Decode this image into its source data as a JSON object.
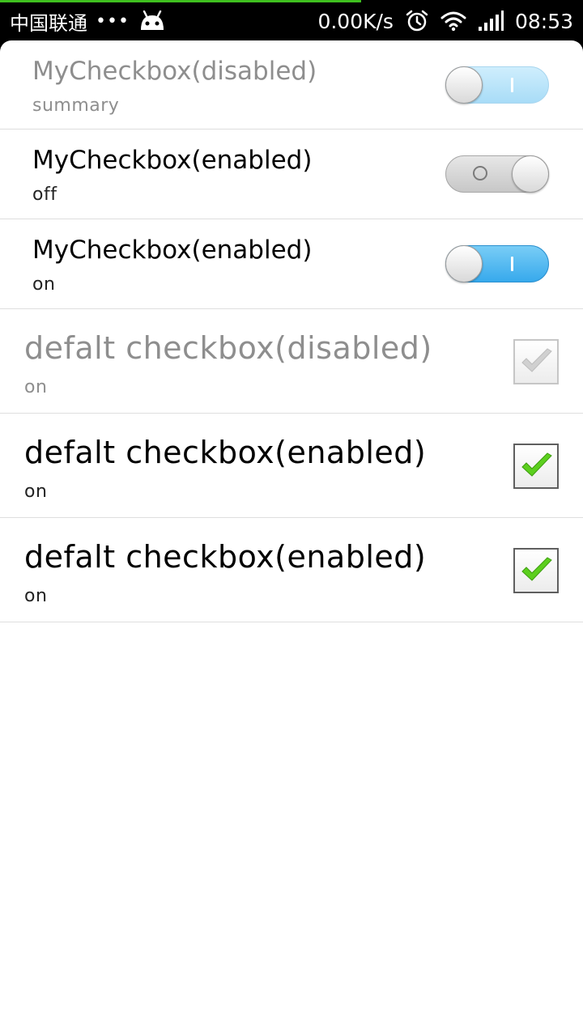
{
  "status_bar": {
    "carrier": "中国联通",
    "dots": "•••",
    "speed": "0.00K/s",
    "time": "08:53",
    "icons": [
      "android-icon",
      "alarm-icon",
      "wifi-icon",
      "signal-icon"
    ],
    "download_progress": 0.62
  },
  "switch_preferences": [
    {
      "title": "MyCheckbox(disabled)",
      "summary": "summary",
      "checked": true,
      "enabled": false
    },
    {
      "title": "MyCheckbox(enabled)",
      "summary": "off",
      "checked": false,
      "enabled": true
    },
    {
      "title": "MyCheckbox(enabled)",
      "summary": "on",
      "checked": true,
      "enabled": true
    }
  ],
  "checkbox_preferences": [
    {
      "title": "defalt checkbox(disabled)",
      "summary": "on",
      "checked": true,
      "enabled": false
    },
    {
      "title": "defalt checkbox(enabled)",
      "summary": "on",
      "checked": true,
      "enabled": true
    },
    {
      "title": "defalt checkbox(enabled)",
      "summary": "on",
      "checked": true,
      "enabled": true
    }
  ],
  "colors": {
    "switch_on": "#37a9ec",
    "switch_on_disabled": "#a8dcf7",
    "switch_off": "#c7c7c7",
    "check_green": "#5ccf1e",
    "check_disabled": "#c8c8c8",
    "divider": "#dedede",
    "progress_green": "#3fbf1f"
  }
}
